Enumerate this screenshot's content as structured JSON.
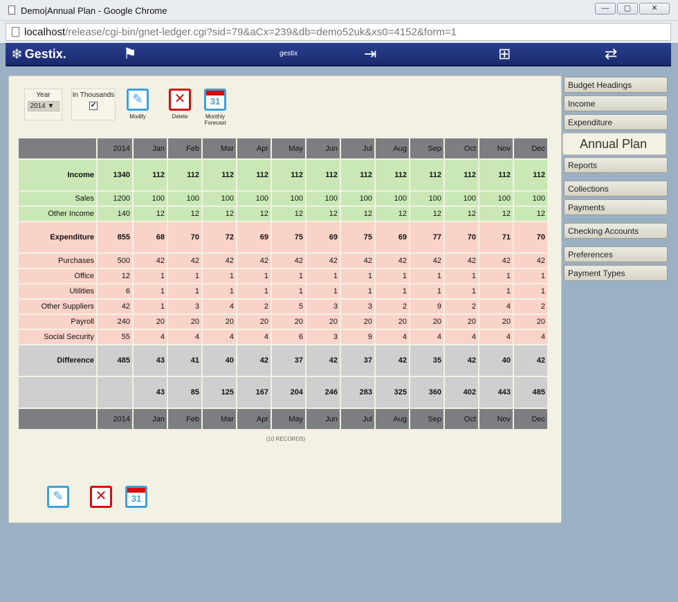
{
  "window": {
    "title": "Demo|Annual Plan - Google Chrome",
    "minimize": "—",
    "maximize": "▢",
    "close": "✕"
  },
  "address": {
    "host": "localhost",
    "path": "/release/cgi-bin/gnet-ledger.cgi?sid=79&aCx=239&db=demo52uk&xs0=4152&form=1"
  },
  "header": {
    "logo": "Gestix.",
    "username": "gestix"
  },
  "toolbar": {
    "year_label": "Year",
    "year_value": "2014 ▼",
    "thousands_label": "In Thousands",
    "thousands_checked": "✔",
    "modify_label": "Modify",
    "delete_label": "Delete",
    "forecast_label": "Monthly Forecast",
    "calendar_day": "31"
  },
  "table": {
    "columns": [
      "2014",
      "Jan",
      "Feb",
      "Mar",
      "Apr",
      "May",
      "Jun",
      "Jul",
      "Aug",
      "Sep",
      "Oct",
      "Nov",
      "Dec"
    ],
    "rows": [
      {
        "label": "Income",
        "values": [
          "1340",
          "112",
          "112",
          "112",
          "112",
          "112",
          "112",
          "112",
          "112",
          "112",
          "112",
          "112",
          "112"
        ]
      },
      {
        "label": "Sales",
        "values": [
          "1200",
          "100",
          "100",
          "100",
          "100",
          "100",
          "100",
          "100",
          "100",
          "100",
          "100",
          "100",
          "100"
        ]
      },
      {
        "label": "Other Income",
        "values": [
          "140",
          "12",
          "12",
          "12",
          "12",
          "12",
          "12",
          "12",
          "12",
          "12",
          "12",
          "12",
          "12"
        ]
      },
      {
        "label": "Expenditure",
        "values": [
          "855",
          "68",
          "70",
          "72",
          "69",
          "75",
          "69",
          "75",
          "69",
          "77",
          "70",
          "71",
          "70"
        ]
      },
      {
        "label": "Purchases",
        "values": [
          "500",
          "42",
          "42",
          "42",
          "42",
          "42",
          "42",
          "42",
          "42",
          "42",
          "42",
          "42",
          "42"
        ]
      },
      {
        "label": "Office",
        "values": [
          "12",
          "1",
          "1",
          "1",
          "1",
          "1",
          "1",
          "1",
          "1",
          "1",
          "1",
          "1",
          "1"
        ]
      },
      {
        "label": "Utilities",
        "values": [
          "6",
          "1",
          "1",
          "1",
          "1",
          "1",
          "1",
          "1",
          "1",
          "1",
          "1",
          "1",
          "1"
        ]
      },
      {
        "label": "Other Suppliers",
        "values": [
          "42",
          "1",
          "3",
          "4",
          "2",
          "5",
          "3",
          "3",
          "2",
          "9",
          "2",
          "4",
          "2"
        ]
      },
      {
        "label": "Payroll",
        "values": [
          "240",
          "20",
          "20",
          "20",
          "20",
          "20",
          "20",
          "20",
          "20",
          "20",
          "20",
          "20",
          "20"
        ]
      },
      {
        "label": "Social Security",
        "values": [
          "55",
          "4",
          "4",
          "4",
          "4",
          "6",
          "3",
          "9",
          "4",
          "4",
          "4",
          "4",
          "4"
        ]
      },
      {
        "label": "Difference",
        "values": [
          "485",
          "43",
          "41",
          "40",
          "42",
          "37",
          "42",
          "37",
          "42",
          "35",
          "42",
          "40",
          "42"
        ]
      },
      {
        "label": "",
        "values": [
          "",
          "43",
          "85",
          "125",
          "167",
          "204",
          "246",
          "283",
          "325",
          "360",
          "402",
          "443",
          "485"
        ]
      }
    ],
    "records": "(10 RECORDS)"
  },
  "menu": {
    "items": [
      "Budget Headings",
      "Income",
      "Expenditure",
      "Annual Plan",
      "Reports",
      "Collections",
      "Payments",
      "Checking Accounts",
      "Preferences",
      "Payment Types"
    ]
  }
}
